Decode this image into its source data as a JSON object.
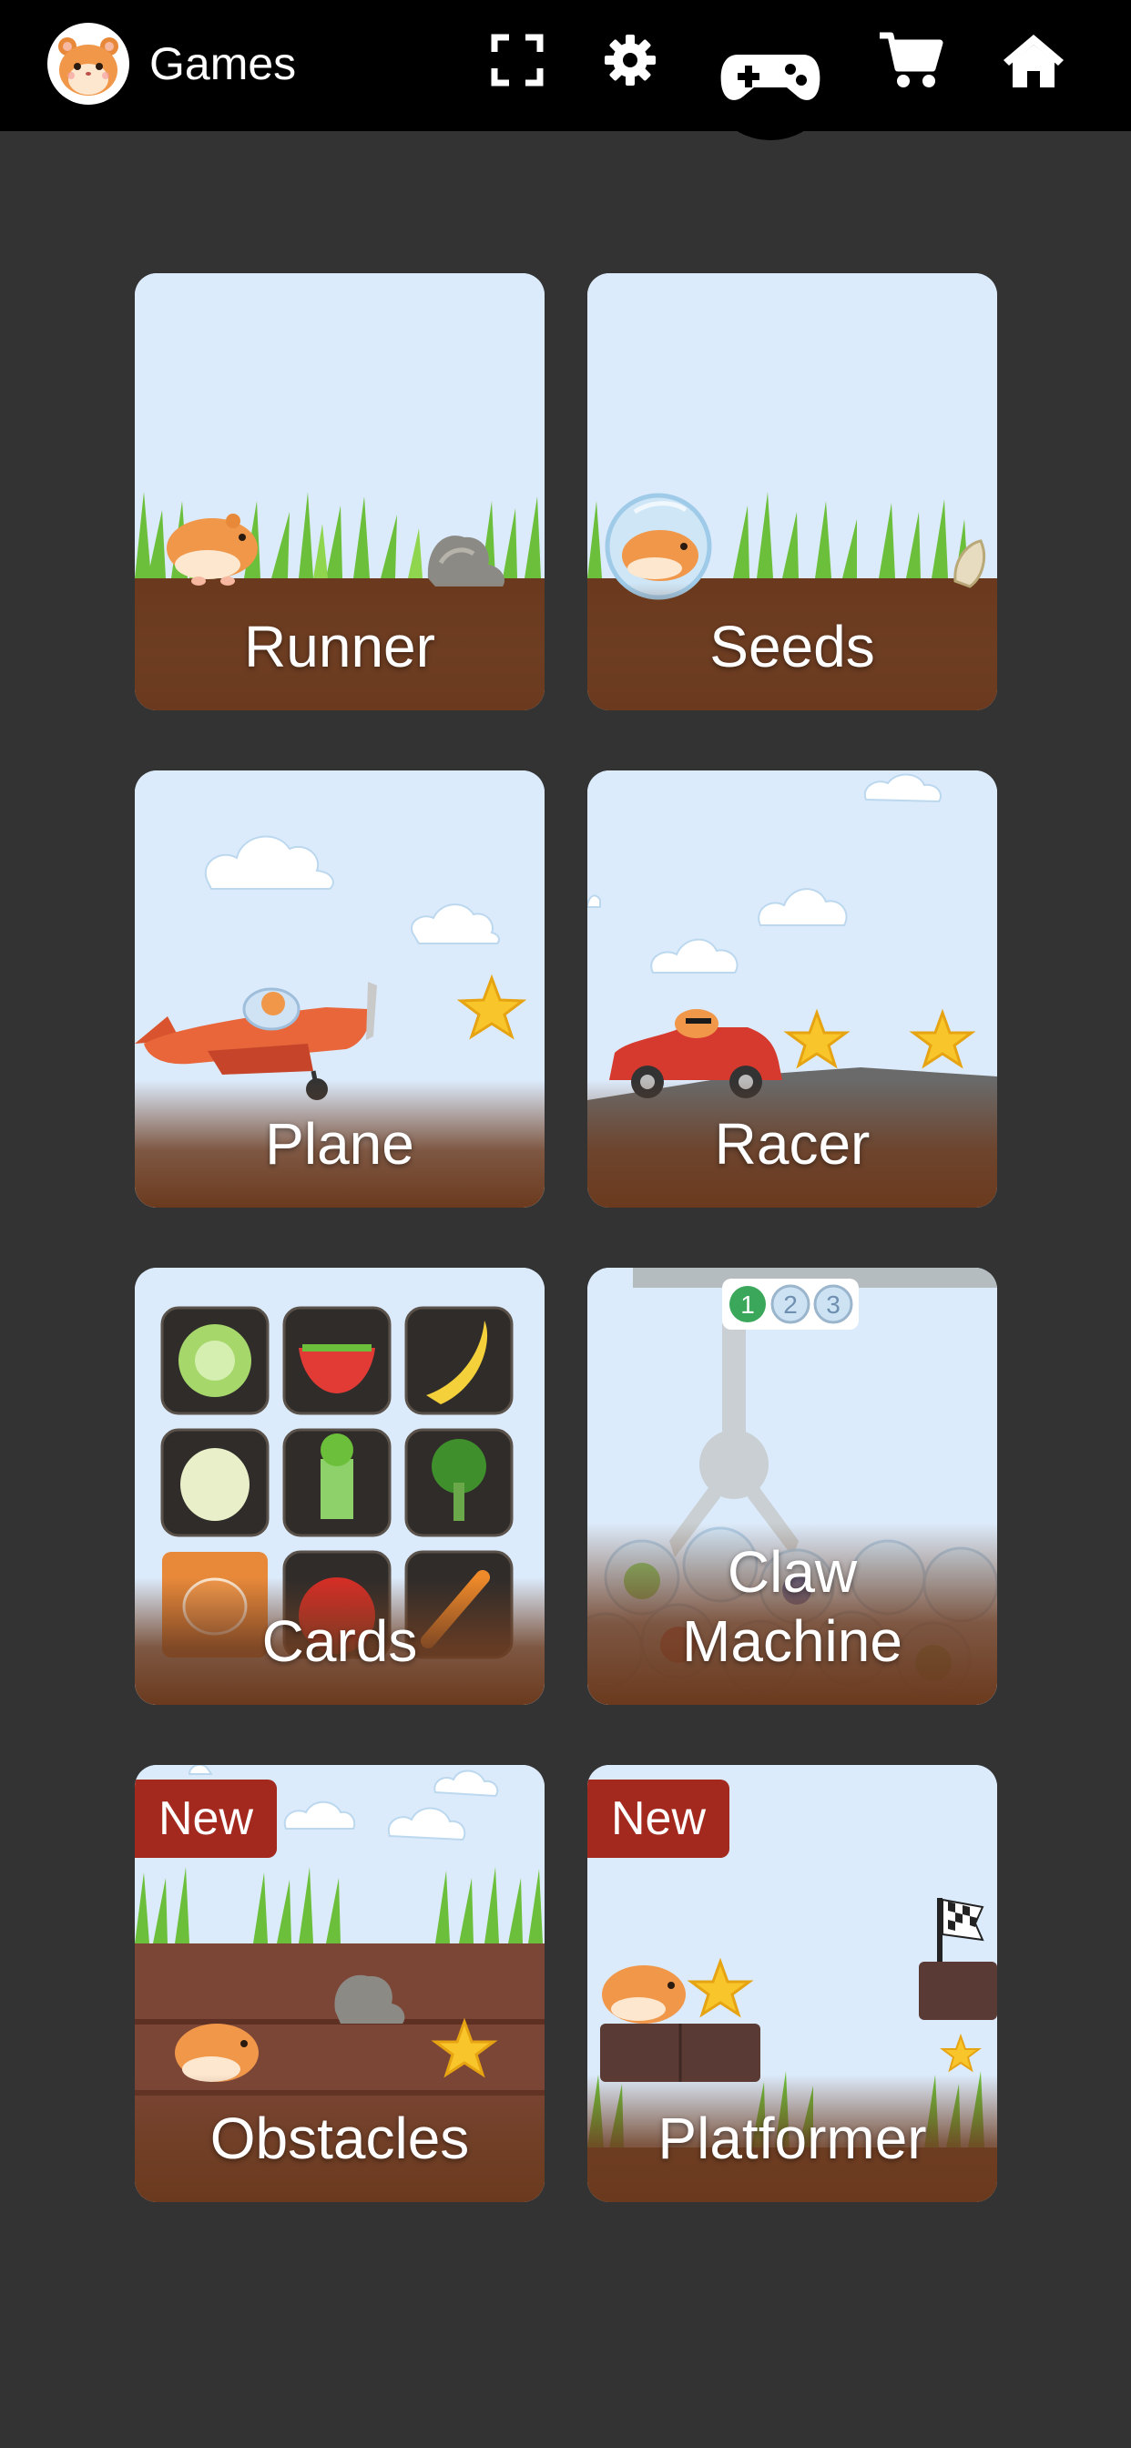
{
  "header": {
    "app_title": "Games",
    "avatar_icon": "hamster-avatar-icon",
    "nav": [
      {
        "icon": "fullscreen-icon"
      },
      {
        "icon": "gear-icon"
      },
      {
        "icon": "gamepad-icon",
        "active": true
      },
      {
        "icon": "cart-icon"
      },
      {
        "icon": "home-icon"
      }
    ]
  },
  "games": [
    {
      "label": "Runner",
      "badge": ""
    },
    {
      "label": "Seeds",
      "badge": ""
    },
    {
      "label": "Plane",
      "badge": ""
    },
    {
      "label": "Racer",
      "badge": ""
    },
    {
      "label": "Cards",
      "badge": ""
    },
    {
      "label": "Claw Machine",
      "badge": "",
      "claw_indicators": [
        "1",
        "2",
        "3"
      ]
    },
    {
      "label": "Obstacles",
      "badge": "New"
    },
    {
      "label": "Platformer",
      "badge": "New"
    }
  ],
  "colors": {
    "background": "#333333",
    "topbar": "#000000",
    "badge": "#a3281d",
    "sky": "#dcebfb",
    "ground": "#6b3a1e"
  }
}
